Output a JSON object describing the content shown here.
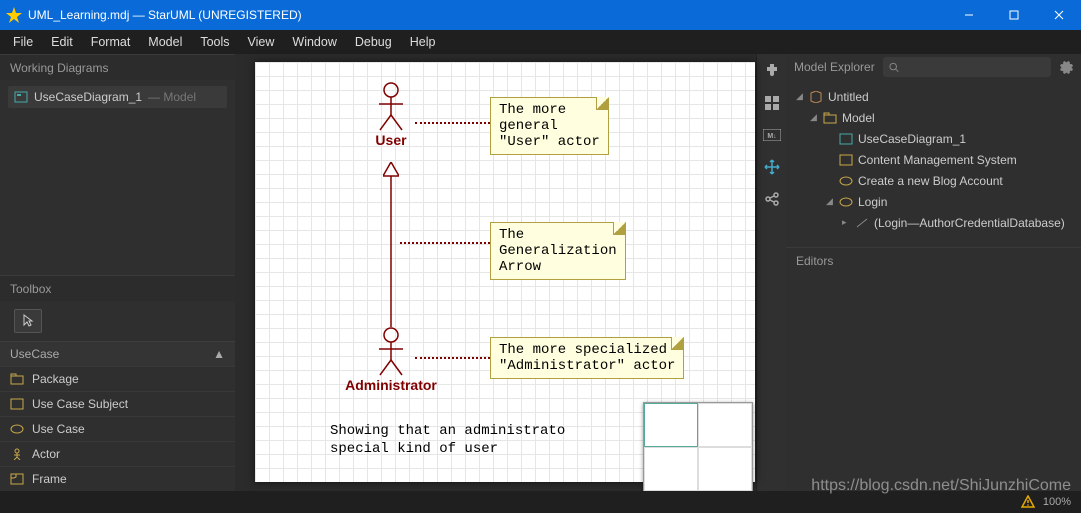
{
  "window": {
    "title": "UML_Learning.mdj — StarUML (UNREGISTERED)"
  },
  "menu": [
    "File",
    "Edit",
    "Format",
    "Model",
    "Tools",
    "View",
    "Window",
    "Debug",
    "Help"
  ],
  "left": {
    "workingDiagrams": "Working Diagrams",
    "wdItem": {
      "name": "UseCaseDiagram_1",
      "sub": "— Model"
    },
    "toolbox": "Toolbox",
    "category": "UseCase",
    "tools": [
      "Package",
      "Use Case Subject",
      "Use Case",
      "Actor",
      "Frame"
    ]
  },
  "diagram": {
    "actorUser": "User",
    "actorAdmin": "Administrator",
    "noteUser": "The more\ngeneral\n\"User\" actor",
    "noteArrow": "The\nGeneralization\nArrow",
    "noteAdmin": "The more specialized\n\"Administrator\" actor",
    "caption": "Showing that an administrato\nspecial kind of user"
  },
  "right": {
    "explorer": "Model Explorer",
    "searchPlaceholder": "",
    "tree": {
      "root": "Untitled",
      "model": "Model",
      "items": [
        "UseCaseDiagram_1",
        "Content Management System",
        "Create a new Blog Account"
      ],
      "login": "Login",
      "loginChild": "(Login—AuthorCredentialDatabase)"
    },
    "editors": "Editors"
  },
  "status": {
    "zoom": "100%"
  },
  "watermark": "https://blog.csdn.net/ShiJunzhiCome"
}
